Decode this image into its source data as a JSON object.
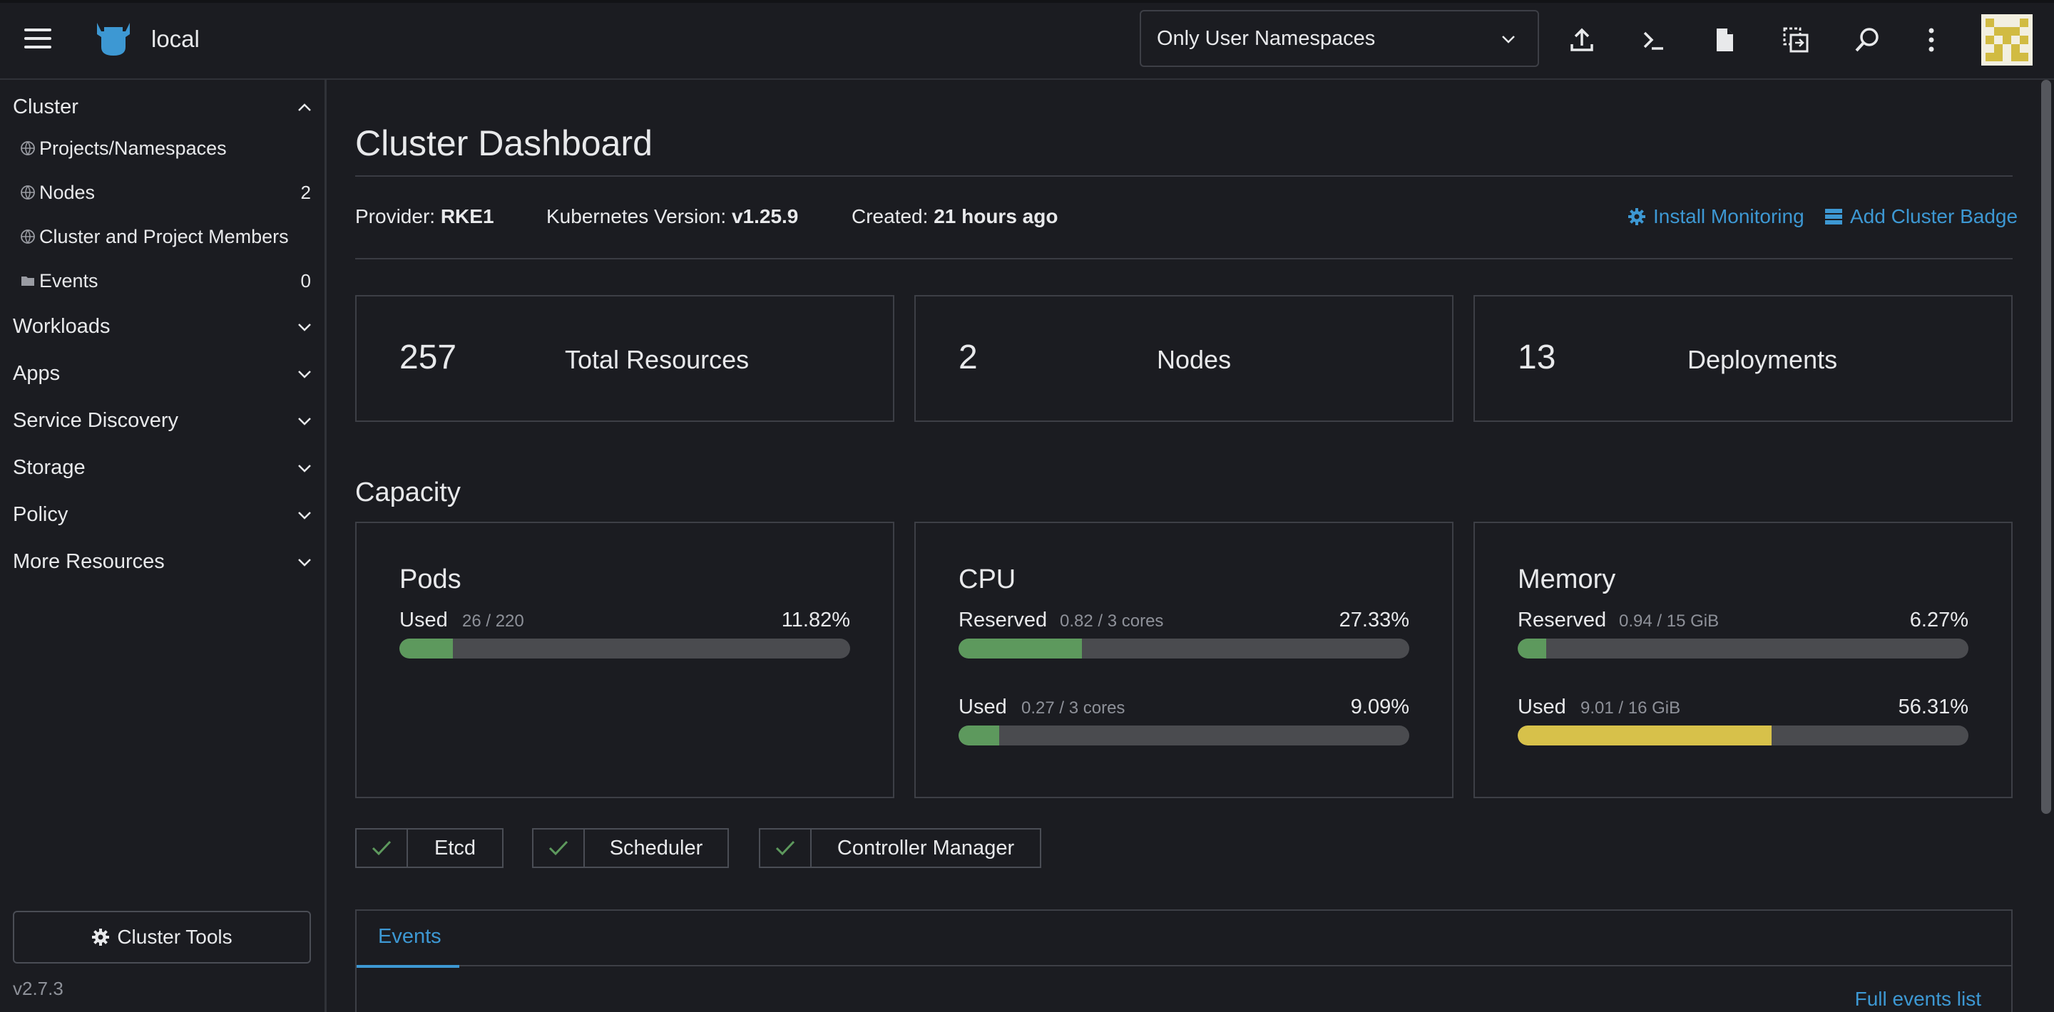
{
  "header": {
    "cluster_name": "local",
    "namespace_filter": "Only User Namespaces",
    "icons": [
      "menu-icon",
      "upload-icon",
      "shell-icon",
      "file-icon",
      "copy-kubeconfig-icon",
      "search-icon",
      "more-vert-icon"
    ]
  },
  "sidebar": {
    "cluster_label": "Cluster",
    "cluster_items": [
      {
        "label": "Projects/Namespaces",
        "count": "",
        "icon": "globe-icon"
      },
      {
        "label": "Nodes",
        "count": "2",
        "icon": "globe-icon"
      },
      {
        "label": "Cluster and Project Members",
        "count": "",
        "icon": "globe-icon"
      },
      {
        "label": "Events",
        "count": "0",
        "icon": "folder-icon"
      }
    ],
    "groups": [
      "Workloads",
      "Apps",
      "Service Discovery",
      "Storage",
      "Policy",
      "More Resources"
    ],
    "cluster_tools": "Cluster Tools",
    "version": "v2.7.3"
  },
  "main": {
    "title": "Cluster Dashboard",
    "meta": {
      "provider_label": "Provider:",
      "provider_value": "RKE1",
      "k8s_label": "Kubernetes Version:",
      "k8s_value": "v1.25.9",
      "created_label": "Created:",
      "created_value": "21 hours ago"
    },
    "actions": {
      "install_monitoring": "Install Monitoring",
      "add_badge": "Add Cluster Badge"
    },
    "stats": [
      {
        "value": "257",
        "label": "Total Resources"
      },
      {
        "value": "2",
        "label": "Nodes"
      },
      {
        "value": "13",
        "label": "Deployments"
      }
    ],
    "capacity_title": "Capacity",
    "capacity": {
      "pods": {
        "title": "Pods",
        "used": {
          "label": "Used",
          "detail": "26 / 220",
          "pct": "11.82%",
          "fraction": 0.1182,
          "color": "#5d995d"
        }
      },
      "cpu": {
        "title": "CPU",
        "reserved": {
          "label": "Reserved",
          "detail": "0.82 / 3 cores",
          "pct": "27.33%",
          "fraction": 0.2733,
          "color": "#5d995d"
        },
        "used": {
          "label": "Used",
          "detail": "0.27 / 3 cores",
          "pct": "9.09%",
          "fraction": 0.0909,
          "color": "#5d995d"
        }
      },
      "memory": {
        "title": "Memory",
        "reserved": {
          "label": "Reserved",
          "detail": "0.94 / 15 GiB",
          "pct": "6.27%",
          "fraction": 0.0627,
          "color": "#5d995d"
        },
        "used": {
          "label": "Used",
          "detail": "9.01 / 16 GiB",
          "pct": "56.31%",
          "fraction": 0.5631,
          "color": "#d7c14a"
        }
      }
    },
    "health": [
      "Etcd",
      "Scheduler",
      "Controller Manager"
    ],
    "events_tab": "Events",
    "full_events_link": "Full events list"
  },
  "colors": {
    "background": "#1b1c21",
    "border": "#3d3f46",
    "link": "#3d98d3",
    "ok_green": "#5d995d",
    "warn_yellow": "#d7c14a",
    "logo_blue": "#3d98d3"
  }
}
